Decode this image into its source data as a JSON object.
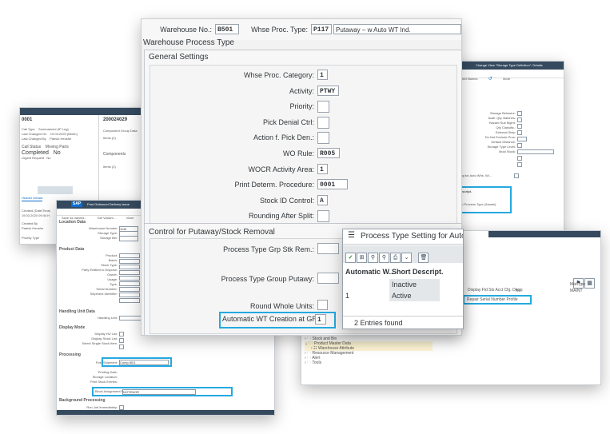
{
  "left_window": {
    "number_left": "0001",
    "number_right": "200024029",
    "status_label": "Call Status",
    "status_value": "Moving Parts",
    "completed_label": "Completed",
    "completed_value": "No",
    "tab_label": "Items (2)",
    "section_label": "Components",
    "header_details": "Header Details"
  },
  "back_left_window": {
    "title": "Post Outbound Delivery Issue",
    "tabs": [
      "Save as Variant...",
      "Get Variant...",
      "More"
    ],
    "sections": [
      "Location Data",
      "Product Data",
      "Handling Unit Data",
      "Display Mode",
      "Processing",
      "Background Processing"
    ],
    "fields_location": [
      "Warehouse Number:",
      "Storage Type:",
      "Storage Bin:"
    ],
    "warehouse_value": "1mD",
    "fields_product": [
      "Product:",
      "Batch:",
      "Stock Type:",
      "Party Entitled to Dispose:",
      "Owner:",
      "Usage:",
      "Type:",
      "Serial Number:",
      "Shipment Identifier:"
    ],
    "fields_hu": [
      "Handling Unit:"
    ],
    "fields_display": [
      "Display HU List:",
      "Display Stock List:",
      "Select Single Stock Item:"
    ],
    "fields_processing": [
      "Post Shipment:",
      "Printing Date:",
      "Storage Location:",
      "Print Stock Entries:",
      "Block Assignment Form:"
    ],
    "processing_value_1": "Comp 80/1",
    "processing_value_2": "NOTENOR",
    "fields_background": [
      "Run Job Immediately:"
    ]
  },
  "right_window": {
    "title": "Change View \"Storage Type Definition\": Details",
    "toolbar": [
      "Field Names",
      "More"
    ],
    "fields": [
      "Storage Behavior:",
      "Avail. Qty. Batches:",
      "Hazard Sub Mgmt:",
      "Qty Classific.:",
      "External Step:",
      "Do Not Exclude Proc:",
      "Default Distance:",
      "Storage Type Level:",
      "Mold Stock:"
    ],
    "setting_line": "e Setting for Auto Whs. Wi...",
    "descr_header": "Descript.",
    "descr_item": "tion Process Type (Assets)"
  },
  "right_bottom_window": {
    "col_no": "No.",
    "col_mattype": "MatType",
    "col_maint": "MAINT",
    "menu_item_1": "Display Fld Sts Acct Cfg. Decis",
    "menu_item_2": "Repair Serial Number Profile",
    "tree": [
      "Stock and Bin",
      "Product Master Data",
      "Warehouse Attribute",
      "Resource Management",
      "Alert",
      "Tools"
    ]
  },
  "main": {
    "warehouse_label": "Warehouse No.:",
    "warehouse_value": "B501",
    "proc_type_label": "Whse Proc. Type:",
    "proc_type_value": "P117",
    "proc_type_desc": "Putaway – w Auto WT Ind.",
    "title": "Warehouse Process Type",
    "general_title": "General Settings",
    "general_fields": [
      {
        "label": "Whse Proc. Category:",
        "value": "1"
      },
      {
        "label": "Activity:",
        "value": "PTWY"
      },
      {
        "label": "Priority:",
        "value": ""
      },
      {
        "label": "Pick Denial Ctrl:",
        "value": ""
      },
      {
        "label": "Action f. Pick Den.:",
        "value": ""
      },
      {
        "label": "WO Rule:",
        "value": "R005"
      },
      {
        "label": "WOCR Activity Area:",
        "value": "1"
      },
      {
        "label": "Print Determ. Procedure:",
        "value": "0001"
      },
      {
        "label": "Stock ID Control:",
        "value": "A"
      },
      {
        "label": "Rounding After Split:",
        "value": ""
      }
    ],
    "control_title": "Control for Putaway/Stock Removal",
    "control_fields": [
      {
        "label": "Process Type Grp Stk Rem.:",
        "value": ""
      },
      {
        "label": "Process Type Group Putawy:",
        "value": ""
      },
      {
        "label": "Round Whole Units:",
        "value": ""
      },
      {
        "label": "Automatic WT Creation at GR:",
        "value": "1"
      }
    ]
  },
  "popup": {
    "title": "Process Type Setting for Autom",
    "col1": "Automatic W..",
    "col2": "Short Descript.",
    "rows": [
      {
        "key": "",
        "desc": "Inactive"
      },
      {
        "key": "1",
        "desc": "Active"
      }
    ],
    "footer": "2 Entries found"
  },
  "colors": {
    "highlight": "#25a9e0",
    "sap_shell": "#354a5f",
    "sap_logo": "#0a6ed1"
  }
}
